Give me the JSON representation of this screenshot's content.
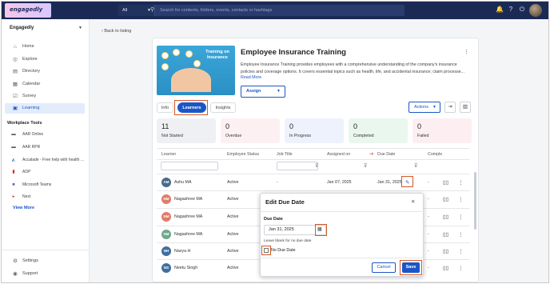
{
  "colors": {
    "brand": "#1b2a55",
    "accent": "#1a56c6",
    "highlight": "#d4582a"
  },
  "topbar": {
    "logo": "engagedly",
    "search_scope": "All",
    "search_placeholder": "Search for contents, folders, events, contacts or hashtags",
    "icons": [
      "bell-icon",
      "help-icon",
      "power-icon"
    ]
  },
  "sidebar": {
    "org": "Engagedly",
    "items": [
      {
        "label": "Home",
        "icon": "home-icon"
      },
      {
        "label": "Explore",
        "icon": "explore-icon"
      },
      {
        "label": "Directory",
        "icon": "directory-icon"
      },
      {
        "label": "Calendar",
        "icon": "calendar-icon"
      },
      {
        "label": "Survey",
        "icon": "survey-icon"
      },
      {
        "label": "Learning",
        "icon": "learning-icon",
        "active": true
      }
    ],
    "tools_title": "Workplace Tools",
    "tools": [
      {
        "label": "AAR Online"
      },
      {
        "label": "AAR RPR"
      },
      {
        "label": "Accalade - Free help with health ..."
      },
      {
        "label": "ADP"
      },
      {
        "label": "Microsoft Teams"
      },
      {
        "label": "Next"
      }
    ],
    "view_more": "View More",
    "settings": "Settings",
    "support": "Support"
  },
  "main": {
    "back": "Back to listing",
    "course": {
      "title": "Employee Insurance Training",
      "image_text": "Training on Insurance",
      "description": "Employee Insurance Training provides employees with a comprehensive understanding of the company's insurance policies and coverage options. It covers essential topics such as health, life, and accidental insurance; claim processe...",
      "read_more": "Read More",
      "assign": "Assign"
    },
    "tabs": [
      "Info",
      "Learners",
      "Insights"
    ],
    "active_tab": "Learners",
    "actions": "Actions",
    "stats": [
      {
        "value": "11",
        "label": "Not Started"
      },
      {
        "value": "0",
        "label": "Overdue"
      },
      {
        "value": "0",
        "label": "In Progress"
      },
      {
        "value": "0",
        "label": "Completed"
      },
      {
        "value": "0",
        "label": "Failed"
      }
    ],
    "table": {
      "headers": [
        "Learner",
        "Employee Status",
        "Job Title",
        "Assigned on",
        "Due Date",
        "Comple"
      ],
      "rows": [
        {
          "initials": "AM",
          "name": "Ashu MA",
          "status": "Active",
          "job": "-",
          "assigned": "Jan 07, 2025",
          "due": "Jan 31, 2025",
          "complete": "-"
        },
        {
          "initials": "NM",
          "name": "Nagashree MA",
          "status": "Active",
          "complete": "-"
        },
        {
          "initials": "NM",
          "name": "Nagashree MA",
          "status": "Active",
          "complete": "-"
        },
        {
          "initials": "NM",
          "name": "Nagashree MA",
          "status": "Active",
          "complete": "-"
        },
        {
          "initials": "NH",
          "name": "Navya H",
          "status": "Active",
          "complete": "-"
        },
        {
          "initials": "NS",
          "name": "Neetu Singh",
          "status": "Active",
          "complete": "-"
        }
      ]
    }
  },
  "modal": {
    "title": "Edit Due Date",
    "due_label": "Due Date",
    "date_value": "Jan 31, 2025",
    "hint": "Leave blank for no due date",
    "no_due_label": "No Due Date",
    "cancel": "Cancel",
    "save": "Save"
  }
}
